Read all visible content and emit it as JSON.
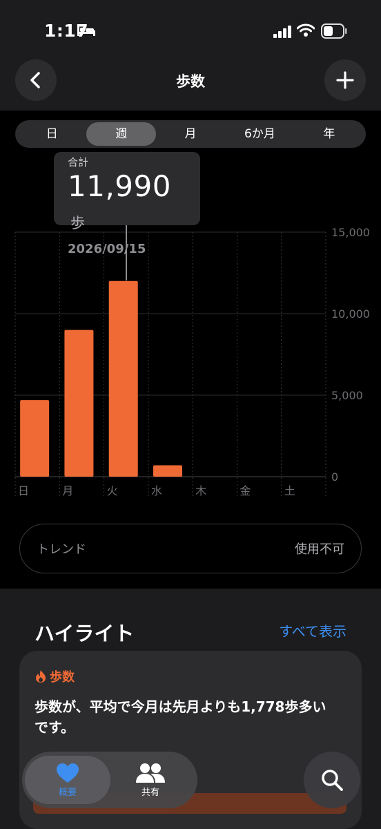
{
  "status": {
    "time": "1:17"
  },
  "nav": {
    "title": "歩数"
  },
  "segments": [
    "日",
    "週",
    "月",
    "6か月",
    "年"
  ],
  "selected_segment": "週",
  "tooltip": {
    "label": "合計",
    "value": "11,990",
    "unit": "歩",
    "date": "2026/09/15"
  },
  "chart_data": {
    "type": "bar",
    "categories": [
      "日",
      "月",
      "火",
      "水",
      "木",
      "金",
      "土"
    ],
    "values": [
      4700,
      9000,
      12000,
      700,
      0,
      0,
      0
    ],
    "highlighted_index": 2,
    "ylim": [
      0,
      15000
    ],
    "yticks": [
      "15,000",
      "10,000",
      "5,000",
      "0"
    ],
    "ytick_values": [
      15000,
      10000,
      5000,
      0
    ],
    "bar_color": "#f06a35",
    "grid": true
  },
  "trend": {
    "label": "トレンド",
    "value": "使用不可"
  },
  "highlights": {
    "title": "ハイライト",
    "see_all": "すべて表示",
    "card": {
      "tag": "歩数",
      "text": "歩数が、平均で今月は先月よりも1,778歩多いです。"
    }
  },
  "tabbar": {
    "summary": "概要",
    "share": "共有"
  },
  "colors": {
    "accent": "#3d8ef0",
    "steps": "#f06a35",
    "background": "#000000",
    "panel": "#1c1c1e"
  }
}
